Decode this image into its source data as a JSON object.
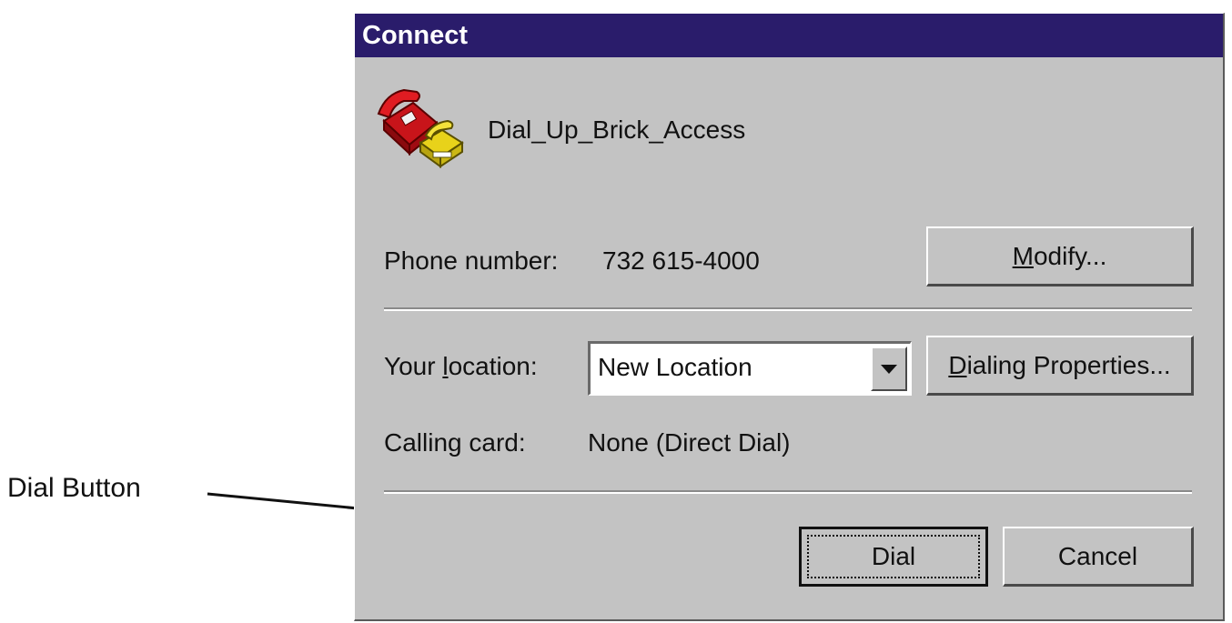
{
  "callout": {
    "label": "Dial Button"
  },
  "dialog": {
    "title": "Connect",
    "connection_name": "Dial_Up_Brick_Access",
    "connection_icon": "telephone-icon",
    "phone": {
      "label": "Phone number:",
      "value": "732 615-4000",
      "modify_button": {
        "mnemonic": "M",
        "rest": "odify..."
      }
    },
    "location": {
      "label_pre": "Your ",
      "label_mnemonic": "l",
      "label_post": "ocation:",
      "selected": "New Location",
      "dialing_properties_button": {
        "mnemonic": "D",
        "rest": "ialing Properties..."
      }
    },
    "calling_card": {
      "label": "Calling card:",
      "value": "None (Direct Dial)"
    },
    "buttons": {
      "dial": "Dial",
      "cancel": "Cancel"
    }
  },
  "colors": {
    "titlebar": "#2a1c6b",
    "dialog_face": "#c3c3c3",
    "text": "#111111"
  }
}
